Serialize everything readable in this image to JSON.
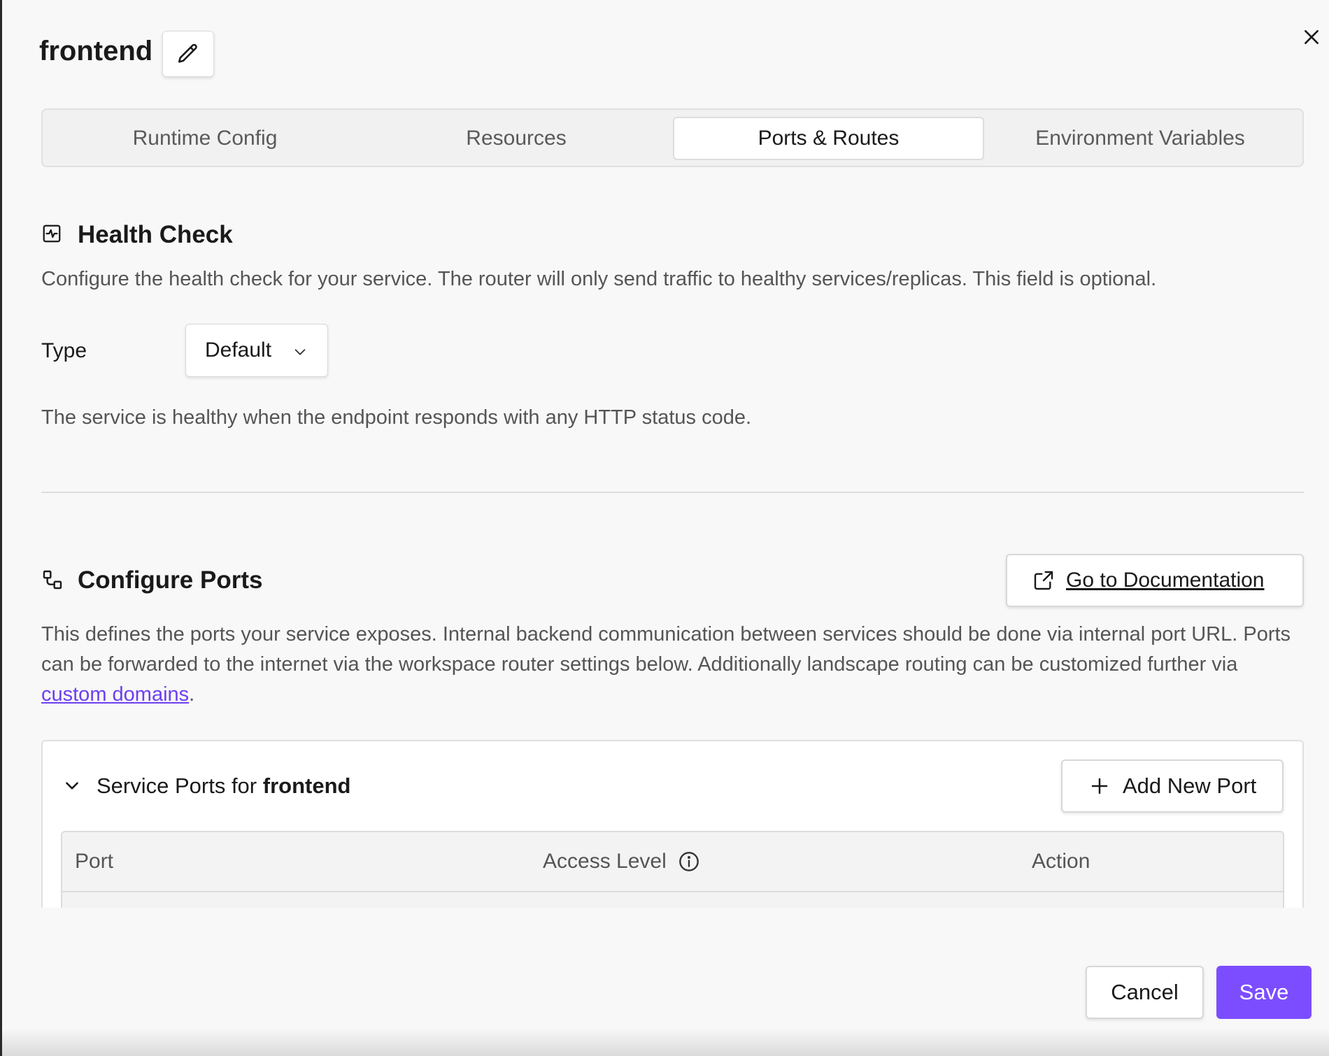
{
  "header": {
    "title": "frontend"
  },
  "tabs": [
    {
      "label": "Runtime Config",
      "active": false
    },
    {
      "label": "Resources",
      "active": false
    },
    {
      "label": "Ports & Routes",
      "active": true
    },
    {
      "label": "Environment Variables",
      "active": false
    }
  ],
  "health_check": {
    "title": "Health Check",
    "description": "Configure the health check for your service. The router will only send traffic to healthy services/replicas. This field is optional.",
    "type_label": "Type",
    "type_value": "Default",
    "note": "The service is healthy when the endpoint responds with any HTTP status code."
  },
  "configure_ports": {
    "title": "Configure Ports",
    "doc_button": "Go to Documentation",
    "description_before_link": "This defines the ports your service exposes. Internal backend communication between services should be done via internal port URL. Ports can be forwarded to the internet via the workspace router settings below. Additionally landscape routing can be customized further via ",
    "link_text": "custom domains",
    "description_after_link": ".",
    "service_ports": {
      "title_prefix": "Service Ports for ",
      "title_service": "frontend",
      "add_button": "Add New Port",
      "columns": [
        "Port",
        "Access Level",
        "Action"
      ]
    }
  },
  "footer": {
    "cancel_label": "Cancel",
    "save_label": "Save"
  },
  "colors": {
    "accent": "#7c4dff",
    "link": "#6d3ff0"
  }
}
